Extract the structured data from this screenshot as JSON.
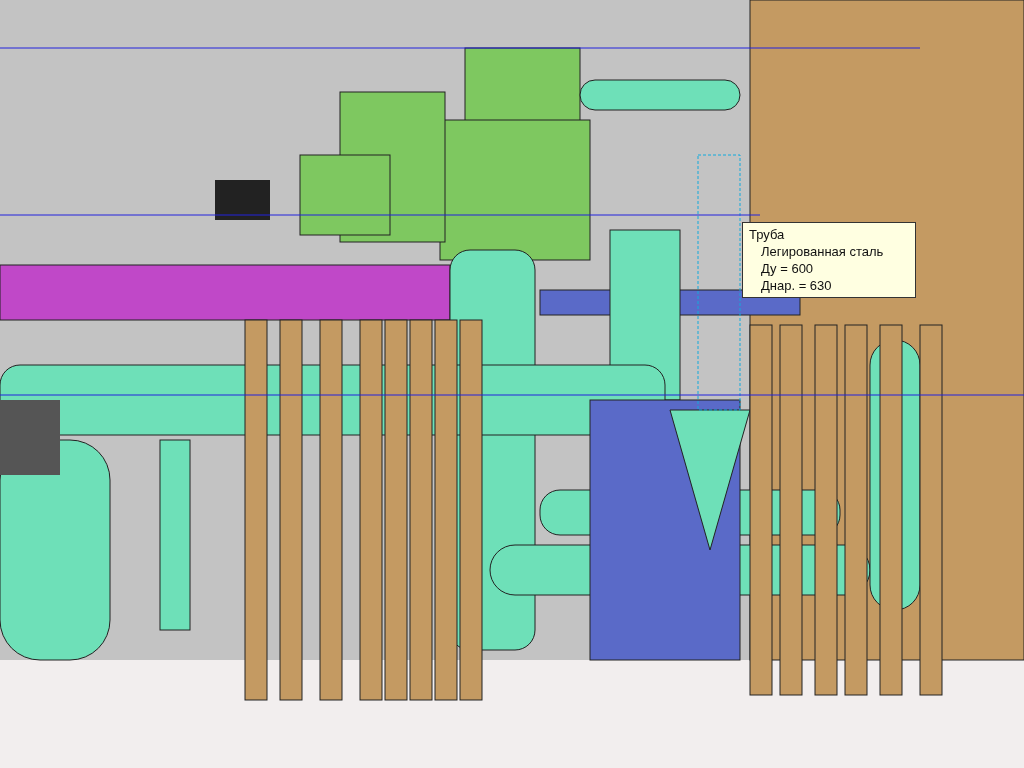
{
  "tooltip": {
    "title": "Труба",
    "lines": [
      "Легированная сталь",
      "Ду = 600",
      "Днар. = 630"
    ]
  }
}
